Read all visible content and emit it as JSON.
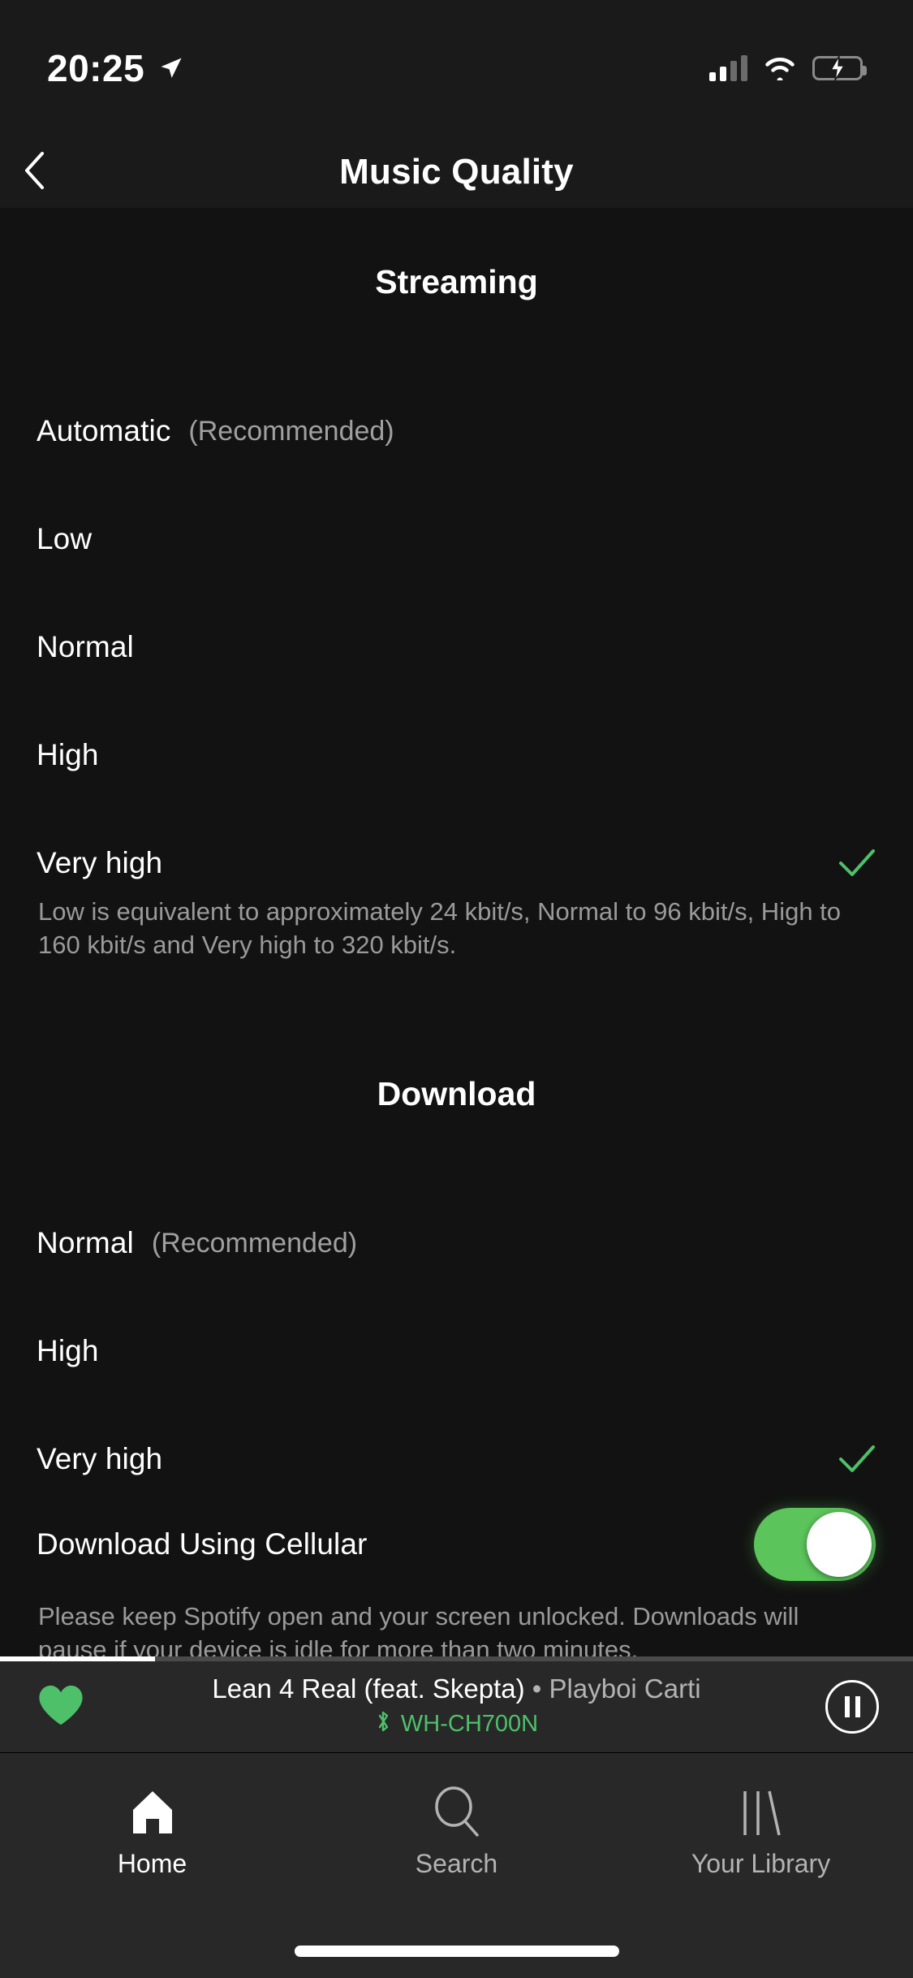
{
  "statusbar": {
    "time": "20:25",
    "location_icon": "location-arrow-icon",
    "cellular_icon": "cellular-signal-icon",
    "cellular_bars_active": 2,
    "cellular_bars_total": 4,
    "wifi_icon": "wifi-icon",
    "battery_icon": "battery-charging-icon",
    "battery_level_percent": 12,
    "battery_color": "#ff3b30"
  },
  "navbar": {
    "back_icon": "chevron-left-icon",
    "title": "Music Quality"
  },
  "streaming": {
    "heading": "Streaming",
    "options": [
      {
        "label": "Automatic",
        "sub": "(Recommended)",
        "selected": false
      },
      {
        "label": "Low",
        "sub": "",
        "selected": false
      },
      {
        "label": "Normal",
        "sub": "",
        "selected": false
      },
      {
        "label": "High",
        "sub": "",
        "selected": false
      },
      {
        "label": "Very high",
        "sub": "",
        "selected": true
      }
    ],
    "description": "Low is equivalent to approximately 24 kbit/s, Normal to 96 kbit/s, High to 160 kbit/s and Very high to 320 kbit/s."
  },
  "download": {
    "heading": "Download",
    "options": [
      {
        "label": "Normal",
        "sub": "(Recommended)",
        "selected": false
      },
      {
        "label": "High",
        "sub": "",
        "selected": false
      },
      {
        "label": "Very high",
        "sub": "",
        "selected": true
      }
    ],
    "cellular_toggle": {
      "label": "Download Using Cellular",
      "state": "on",
      "color": "#5bc45b"
    },
    "description": "Please keep Spotify open and your screen unlocked. Downloads will pause if your device is idle for more than two minutes."
  },
  "nowplaying": {
    "heart_icon": "heart-filled-icon",
    "heart_color": "#4ec06a",
    "track": "Lean 4 Real (feat. Skepta)",
    "separator": " • ",
    "artist": "Playboi Carti",
    "bluetooth_icon": "bluetooth-icon",
    "device": "WH-CH700N",
    "device_color": "#4ec06a",
    "play_state_icon": "pause-icon",
    "progress_percent": 17
  },
  "tabbar": {
    "tabs": [
      {
        "label": "Home",
        "icon": "home-icon",
        "active": true
      },
      {
        "label": "Search",
        "icon": "search-icon",
        "active": false
      },
      {
        "label": "Your Library",
        "icon": "library-icon",
        "active": false
      }
    ]
  },
  "theme": {
    "accent_green": "#4ec06a",
    "background": "#121212",
    "bar_background": "#282828",
    "header_background": "#1a1a1a"
  }
}
